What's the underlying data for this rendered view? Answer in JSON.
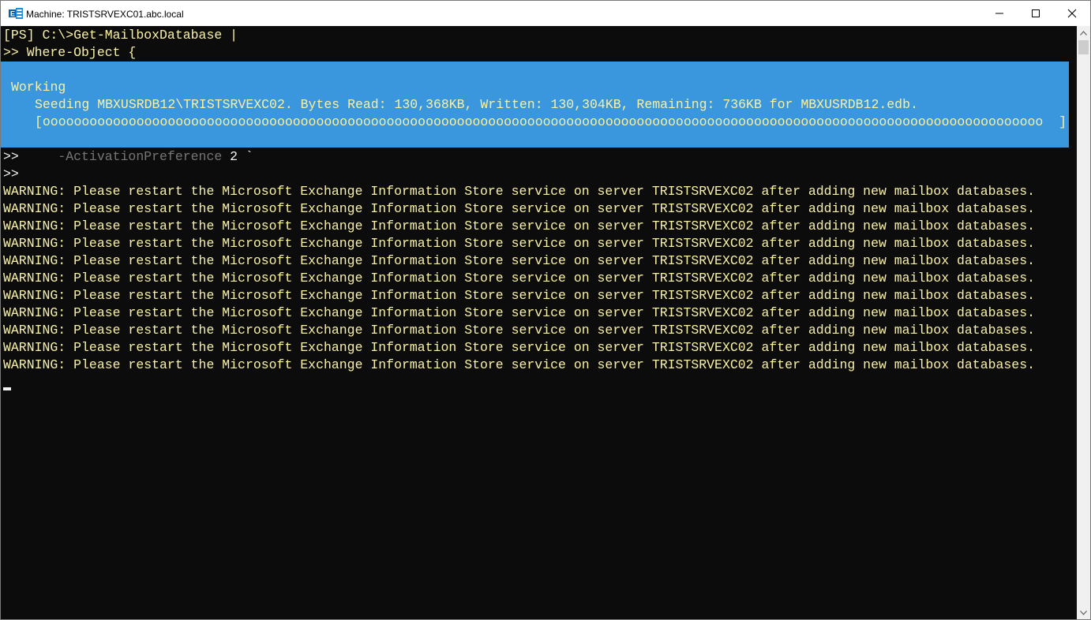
{
  "window": {
    "title": "Machine: TRISTSRVEXC01.abc.local",
    "icon": "exchange-shell-icon",
    "controls": [
      "minimize-icon",
      "maximize-icon",
      "close-icon"
    ]
  },
  "console": {
    "line_prompt": "[PS] C:\\>Get-MailboxDatabase |",
    "line_where": ">> Where-Object {",
    "progress": {
      "activity": "Working",
      "status": "Seeding MBXUSRDB12\\TRISTSRVEXC02. Bytes Read: 130,368KB, Written: 130,304KB, Remaining: 736KB for MBXUSRDB12.edb.",
      "bar": "[oooooooooooooooooooooooooooooooooooooooooooooooooooooooooooooooooooooooooooooooooooooooooooooooooooooooooooooooooooooooooooooooo  ]"
    },
    "line_param_prefix": ">>     ",
    "line_param_name": "-ActivationPreference",
    "line_param_value": " 2 `",
    "line_continuation": ">>",
    "warnings": [
      "WARNING: Please restart the Microsoft Exchange Information Store service on server TRISTSRVEXC02 after adding new mailbox databases.",
      "WARNING: Please restart the Microsoft Exchange Information Store service on server TRISTSRVEXC02 after adding new mailbox databases.",
      "WARNING: Please restart the Microsoft Exchange Information Store service on server TRISTSRVEXC02 after adding new mailbox databases.",
      "WARNING: Please restart the Microsoft Exchange Information Store service on server TRISTSRVEXC02 after adding new mailbox databases.",
      "WARNING: Please restart the Microsoft Exchange Information Store service on server TRISTSRVEXC02 after adding new mailbox databases.",
      "WARNING: Please restart the Microsoft Exchange Information Store service on server TRISTSRVEXC02 after adding new mailbox databases.",
      "WARNING: Please restart the Microsoft Exchange Information Store service on server TRISTSRVEXC02 after adding new mailbox databases.",
      "WARNING: Please restart the Microsoft Exchange Information Store service on server TRISTSRVEXC02 after adding new mailbox databases.",
      "WARNING: Please restart the Microsoft Exchange Information Store service on server TRISTSRVEXC02 after adding new mailbox databases.",
      "WARNING: Please restart the Microsoft Exchange Information Store service on server TRISTSRVEXC02 after adding new mailbox databases.",
      "WARNING: Please restart the Microsoft Exchange Information Store service on server TRISTSRVEXC02 after adding new mailbox databases."
    ]
  },
  "colors": {
    "background": "#0c0c0c",
    "warning_text": "#f9f1a5",
    "progress_background": "#3a96dd",
    "parameter_text": "#767676"
  }
}
